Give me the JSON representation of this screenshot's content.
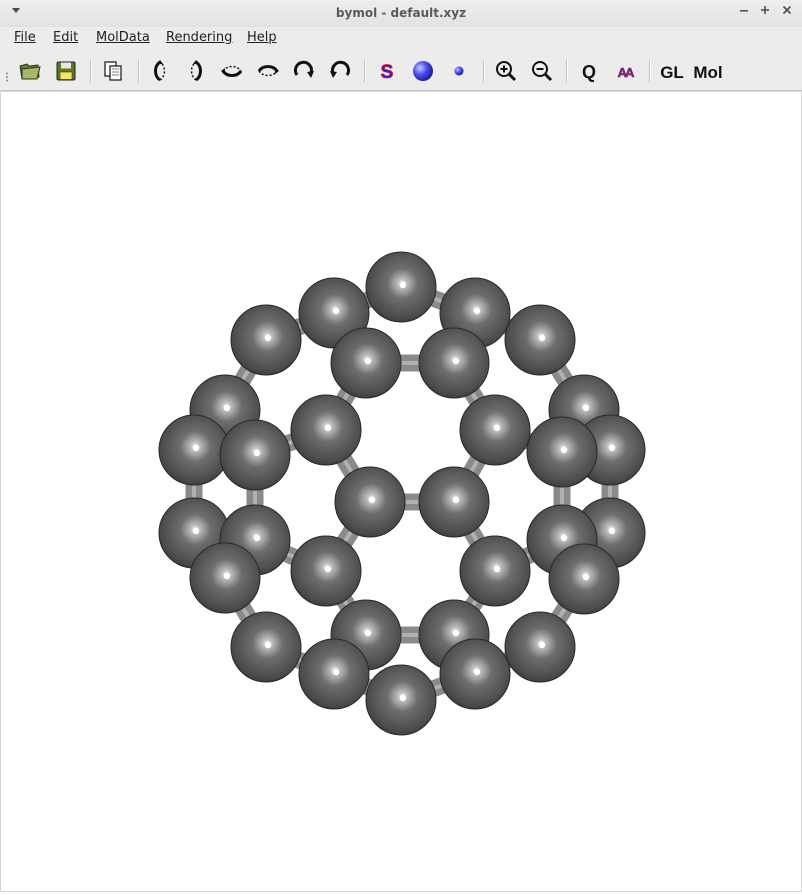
{
  "window": {
    "title": "bymol - default.xyz"
  },
  "menu": {
    "items": [
      "File",
      "Edit",
      "MolData",
      "Rendering",
      "Help"
    ]
  },
  "toolbar": {
    "s_label": "S",
    "q_label": "Q",
    "aa_label": "AA",
    "gl_label": "GL",
    "mol_label": "Mol"
  },
  "viewer": {
    "atom_color": "#5a5a5a",
    "bond_color": "#8a8a8a"
  }
}
